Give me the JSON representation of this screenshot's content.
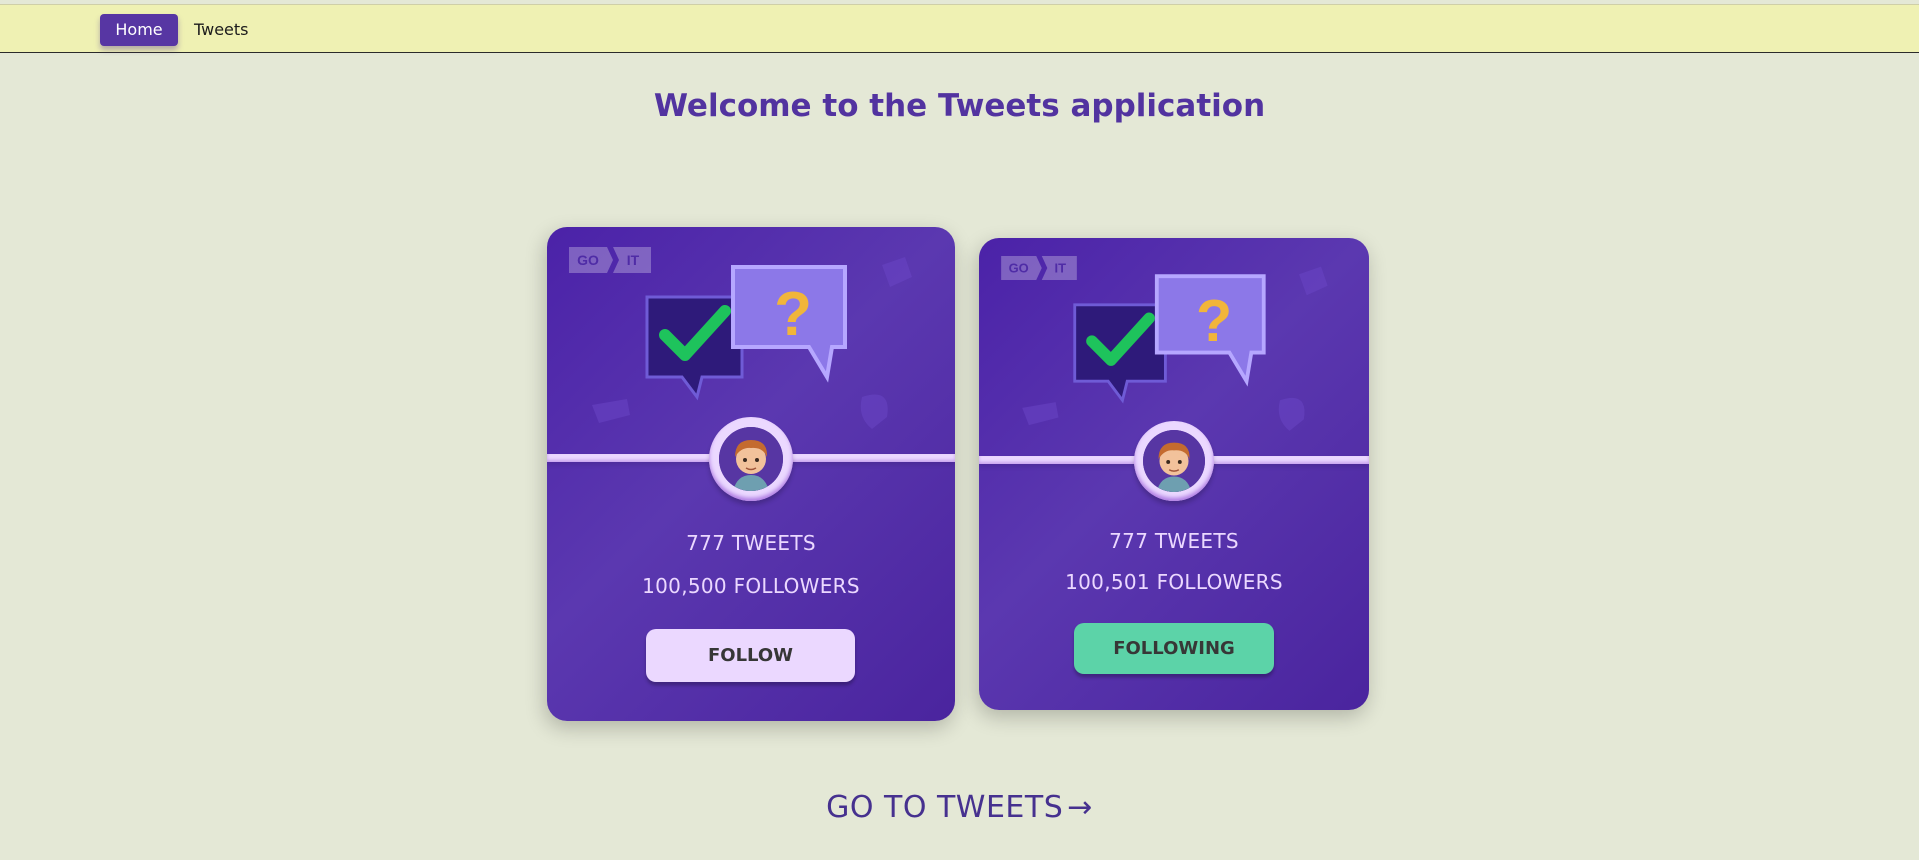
{
  "nav": {
    "home_label": "Home",
    "tweets_label": "Tweets"
  },
  "page": {
    "title": "Welcome to the Tweets application"
  },
  "logo": {
    "left": "GO",
    "right": "IT"
  },
  "cards": [
    {
      "tweets": "777 TWEETS",
      "followers": "100,500 FOLLOWERS",
      "button_label": "FOLLOW",
      "button_color": "#ebd8ff"
    },
    {
      "tweets": "777 TWEETS",
      "followers": "100,501 FOLLOWERS",
      "button_label": "FOLLOWING",
      "button_color": "#5cd3a8"
    }
  ],
  "cta": {
    "label": "GO TO TWEETS",
    "arrow": "→"
  },
  "colors": {
    "background": "#e4e8d6",
    "header": "#eff1b3",
    "accent": "#5736a3",
    "card_text": "#ebd8ff"
  }
}
